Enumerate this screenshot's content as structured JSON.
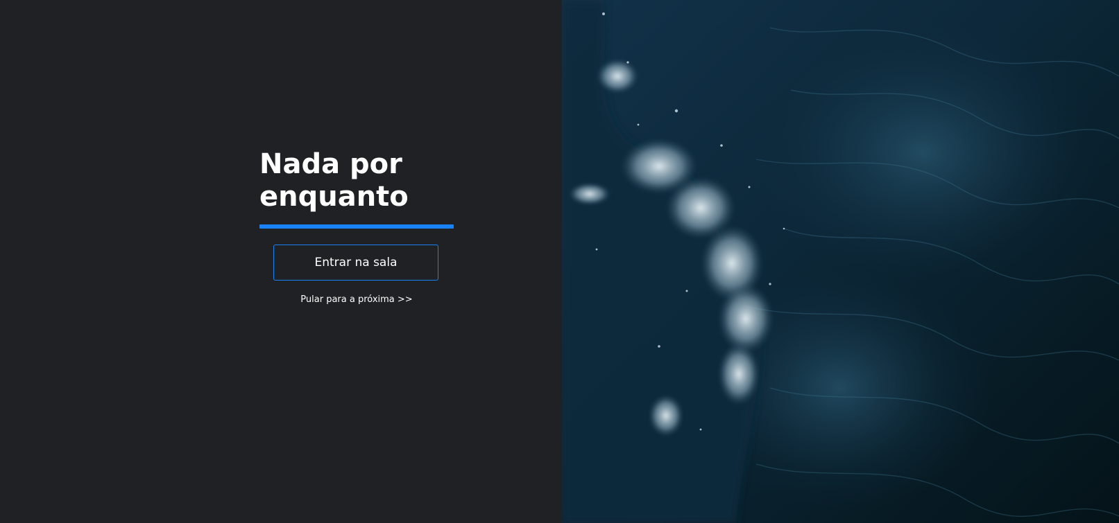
{
  "main": {
    "title": "Nada por enquanto",
    "enter_button_label": "Entrar na sala",
    "skip_link_label": "Pular para a próxima >>"
  },
  "colors": {
    "background": "#202125",
    "accent": "#1a82f7",
    "button_border": "#1a82f7",
    "text": "#ffffff",
    "water_dark": "#0a1c28"
  },
  "hero_image": {
    "description_icon": "ocean-waves-image"
  }
}
